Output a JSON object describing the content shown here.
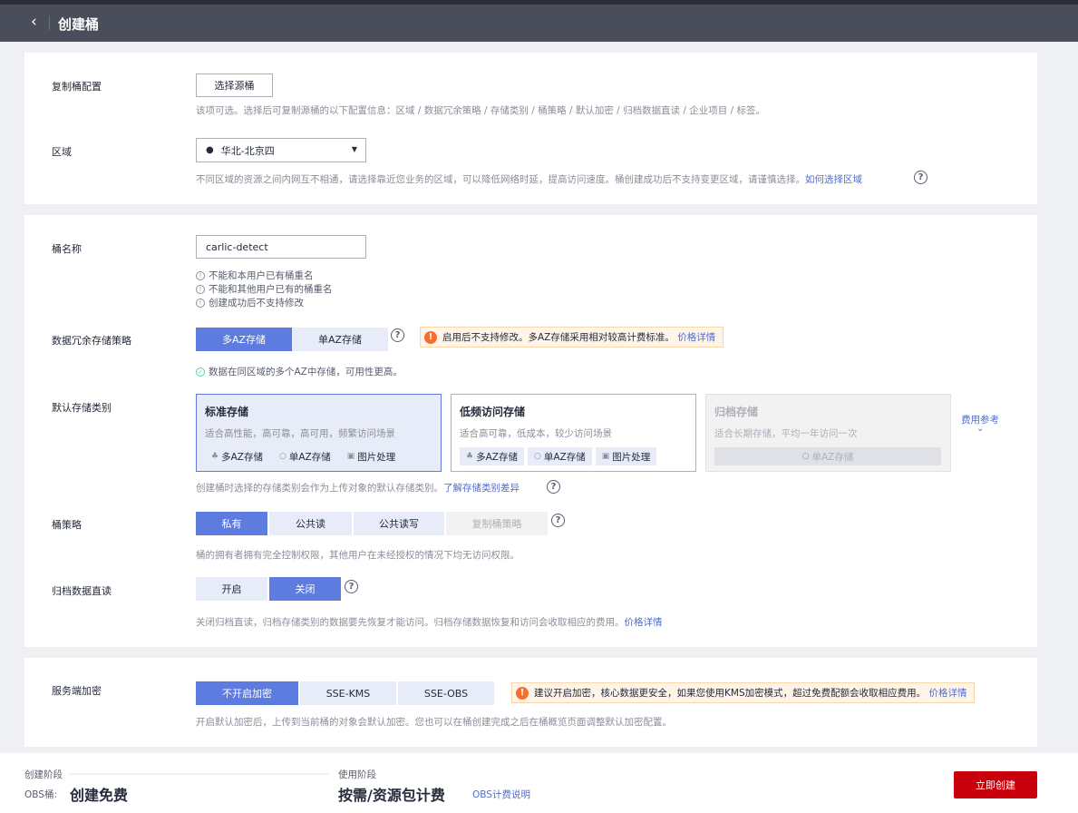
{
  "header": {
    "title": "创建桶"
  },
  "replicate": {
    "label": "复制桶配置",
    "button": "选择源桶",
    "hint": "该项可选。选择后可复制源桶的以下配置信息：区域 / 数据冗余策略 / 存储类别 / 桶策略 / 默认加密 / 归档数据直读 / 企业项目 / 标签。"
  },
  "region": {
    "label": "区域",
    "value": "华北-北京四",
    "hint": "不同区域的资源之间内网互不相通，请选择靠近您业务的区域，可以降低网络时延，提高访问速度。桶创建成功后不支持变更区域，请谨慎选择。",
    "link": "如何选择区域"
  },
  "bucket_name": {
    "label": "桶名称",
    "value": "carlic-detect",
    "rules": [
      "不能和本用户已有桶重名",
      "不能和其他用户已有的桶重名",
      "创建成功后不支持修改"
    ]
  },
  "redundancy": {
    "label": "数据冗余存储策略",
    "options": [
      "多AZ存储",
      "单AZ存储"
    ],
    "selected": "多AZ存储",
    "warning": "启用后不支持修改。多AZ存储采用相对较高计费标准。",
    "warning_link": "价格详情",
    "hint": "数据在同区域的多个AZ中存储，可用性更高。"
  },
  "storage_class": {
    "label": "默认存储类别",
    "cards": [
      {
        "title": "标准存储",
        "desc": "适合高性能，高可靠，高可用，频繁访问场景",
        "tags": [
          "多AZ存储",
          "单AZ存储",
          "图片处理"
        ]
      },
      {
        "title": "低频访问存储",
        "desc": "适合高可靠，低成本，较少访问场景",
        "tags": [
          "多AZ存储",
          "单AZ存储",
          "图片处理"
        ]
      },
      {
        "title": "归档存储",
        "desc": "适合长期存储，平均一年访问一次",
        "tags": [
          "单AZ存储"
        ]
      }
    ],
    "fee_link": "费用参考",
    "hint": "创建桶时选择的存储类别会作为上传对象的默认存储类别。",
    "hint_link": "了解存储类别差异"
  },
  "policy": {
    "label": "桶策略",
    "options": [
      "私有",
      "公共读",
      "公共读写",
      "复制桶策略"
    ],
    "selected": "私有",
    "hint": "桶的拥有者拥有完全控制权限，其他用户在未经授权的情况下均无访问权限。"
  },
  "archive_read": {
    "label": "归档数据直读",
    "options": [
      "开启",
      "关闭"
    ],
    "selected": "关闭",
    "hint": "关闭归档直读，归档存储类别的数据要先恢复才能访问。归档存储数据恢复和访问会收取相应的费用。",
    "hint_link": "价格详情"
  },
  "encryption": {
    "label": "服务端加密",
    "options": [
      "不开启加密",
      "SSE-KMS",
      "SSE-OBS"
    ],
    "selected": "不开启加密",
    "warning": "建议开启加密，核心数据更安全，如果您使用KMS加密模式，超过免费配额会收取相应费用。",
    "warning_link": "价格详情",
    "hint": "开启默认加密后，上传到当前桶的对象会默认加密。您也可以在桶创建完成之后在桶概览页面调整默认加密配置。"
  },
  "footer": {
    "create_stage": "创建阶段",
    "obs_label": "OBS桶:",
    "create_price": "创建免费",
    "use_stage": "使用阶段",
    "use_price": "按需/资源包计费",
    "billing_link": "OBS计费说明",
    "submit": "立即创建"
  },
  "colors": {
    "primary": "#5e7ce0",
    "danger": "#c7000b",
    "header": "#4a4e5b"
  }
}
